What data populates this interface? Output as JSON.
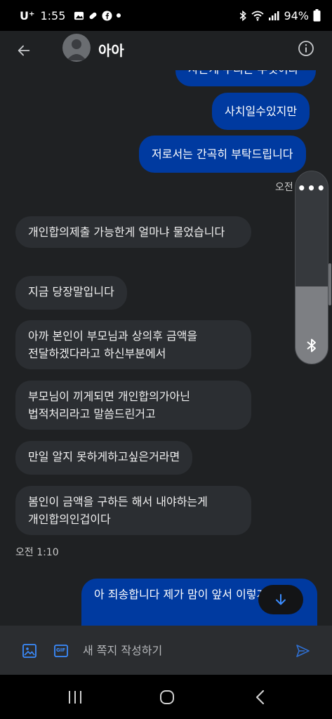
{
  "status_bar": {
    "carrier": "U⁺",
    "time": "1:55",
    "battery": "94%"
  },
  "header": {
    "contact_name": "아아",
    "back_icon": "arrow-left-icon",
    "info_icon": "info-circle-icon"
  },
  "messages": [
    {
      "id": "m0",
      "type": "sent",
      "text": "사는게 우리는 무엇이라"
    },
    {
      "id": "m1",
      "type": "sent",
      "text": "사치일수있지만"
    },
    {
      "id": "m2",
      "type": "sent",
      "text": "저로서는 간곡히 부탁드립니다"
    },
    {
      "id": "t1",
      "type": "time",
      "text": "오전"
    },
    {
      "id": "m3",
      "type": "recv",
      "text": "개인합의제출 가능한게 얼마냐 물었습니다"
    },
    {
      "id": "m4",
      "type": "recv",
      "text": "지금 당장말입니다"
    },
    {
      "id": "m5",
      "type": "recv",
      "text": "아까 본인이 부모님과 상의후 금액을 전달하겠다라고 하신부분에서"
    },
    {
      "id": "m6",
      "type": "recv",
      "text": "부모님이 끼게되면 개인합의가아닌 법적처리라고 말씀드린거고"
    },
    {
      "id": "m7",
      "type": "recv",
      "text": "만일 알지 못하게하고싶은거라면"
    },
    {
      "id": "m8",
      "type": "recv",
      "text": "봄인이 금액을 구하든 해서 내야하는게 개인합의인겁이다"
    },
    {
      "id": "t2",
      "type": "time",
      "text": "오전 1:10"
    },
    {
      "id": "m9",
      "type": "sent",
      "text": "아 죄송합니다 제가 맘이 앞서 이렇게 요"
    }
  ],
  "floating_panel": {
    "more_label": "•••",
    "bluetooth_icon": "bluetooth-icon"
  },
  "composer": {
    "placeholder": "새 쪽지 작성하기",
    "gallery_icon": "image-icon",
    "gif_label": "GIF",
    "send_icon": "send-icon"
  },
  "colors": {
    "sent_bubble": "#003aa0",
    "recv_bubble": "#2b2e32",
    "background": "#1f2123",
    "accent": "#3b8cff"
  }
}
